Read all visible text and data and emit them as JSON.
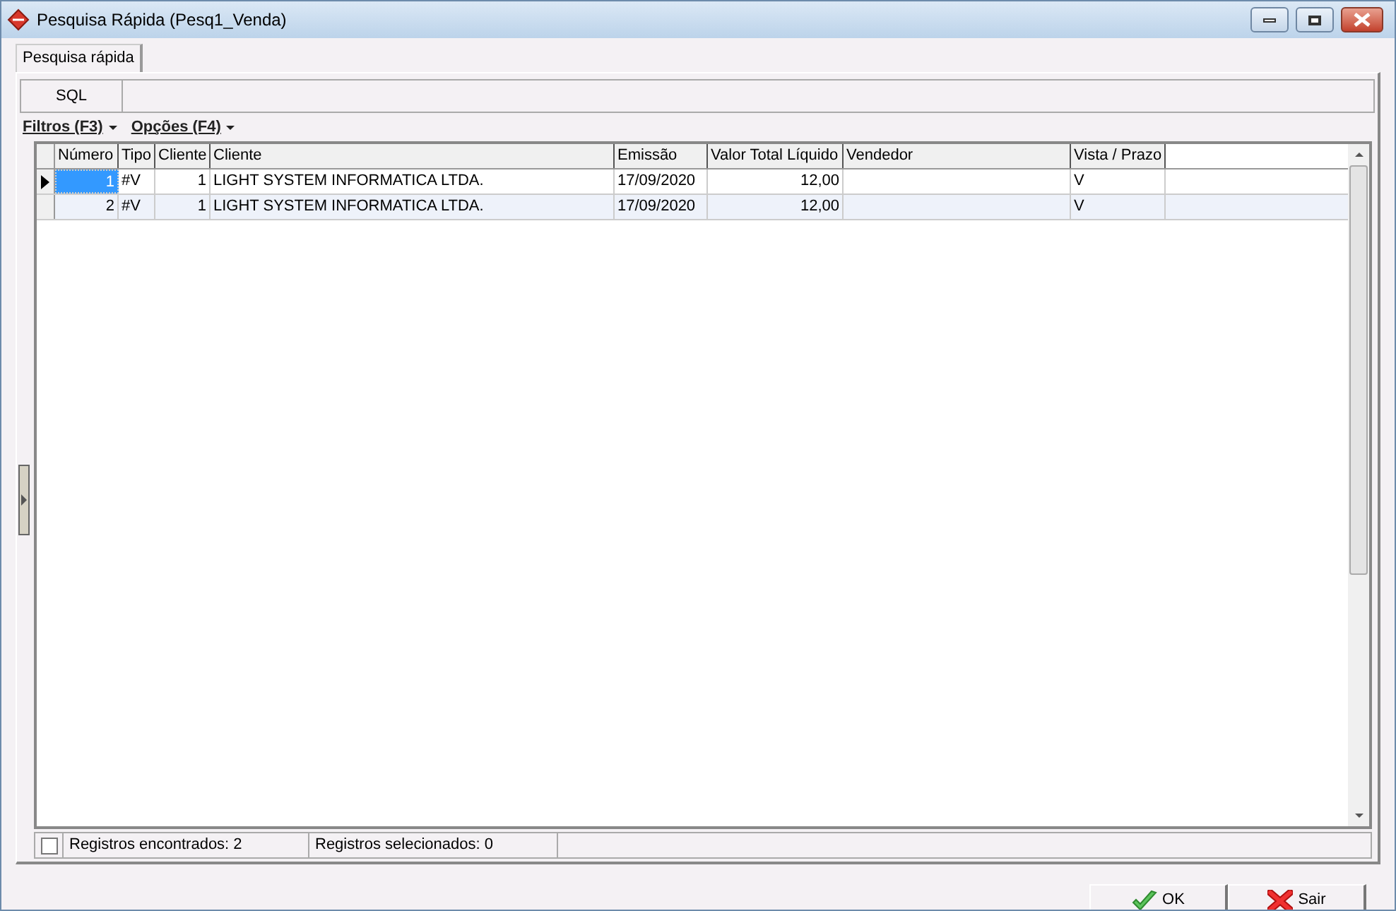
{
  "window": {
    "title": "Pesquisa Rápida (Pesq1_Venda)"
  },
  "tabs": [
    {
      "label": "Pesquisa rápida",
      "selected": true
    }
  ],
  "sql": {
    "label": "SQL"
  },
  "menus": [
    "Filtros (F3)",
    "Opções (F4)"
  ],
  "table": {
    "columns": [
      "Número",
      "Tipo",
      "Cliente",
      "Cliente",
      "Emissão",
      "Valor Total Líquido",
      "Vendedor",
      "Vista / Prazo"
    ],
    "rows": [
      {
        "selected": true,
        "cells": [
          "1",
          "#V",
          "1",
          "LIGHT SYSTEM INFORMATICA LTDA.",
          "17/09/2020",
          "12,00",
          "",
          "V"
        ]
      },
      {
        "selected": false,
        "cells": [
          "2",
          "#V",
          "1",
          "LIGHT SYSTEM INFORMATICA LTDA.",
          "17/09/2020",
          "12,00",
          "",
          "V"
        ]
      }
    ]
  },
  "status_bar": {
    "checked": false,
    "found": "Registros encontrados: 2",
    "selected_count": "Registros selecionados: 0"
  },
  "buttons": [
    {
      "kind": "ok",
      "label": "OK"
    },
    {
      "kind": "exit",
      "label": "Sair"
    }
  ]
}
